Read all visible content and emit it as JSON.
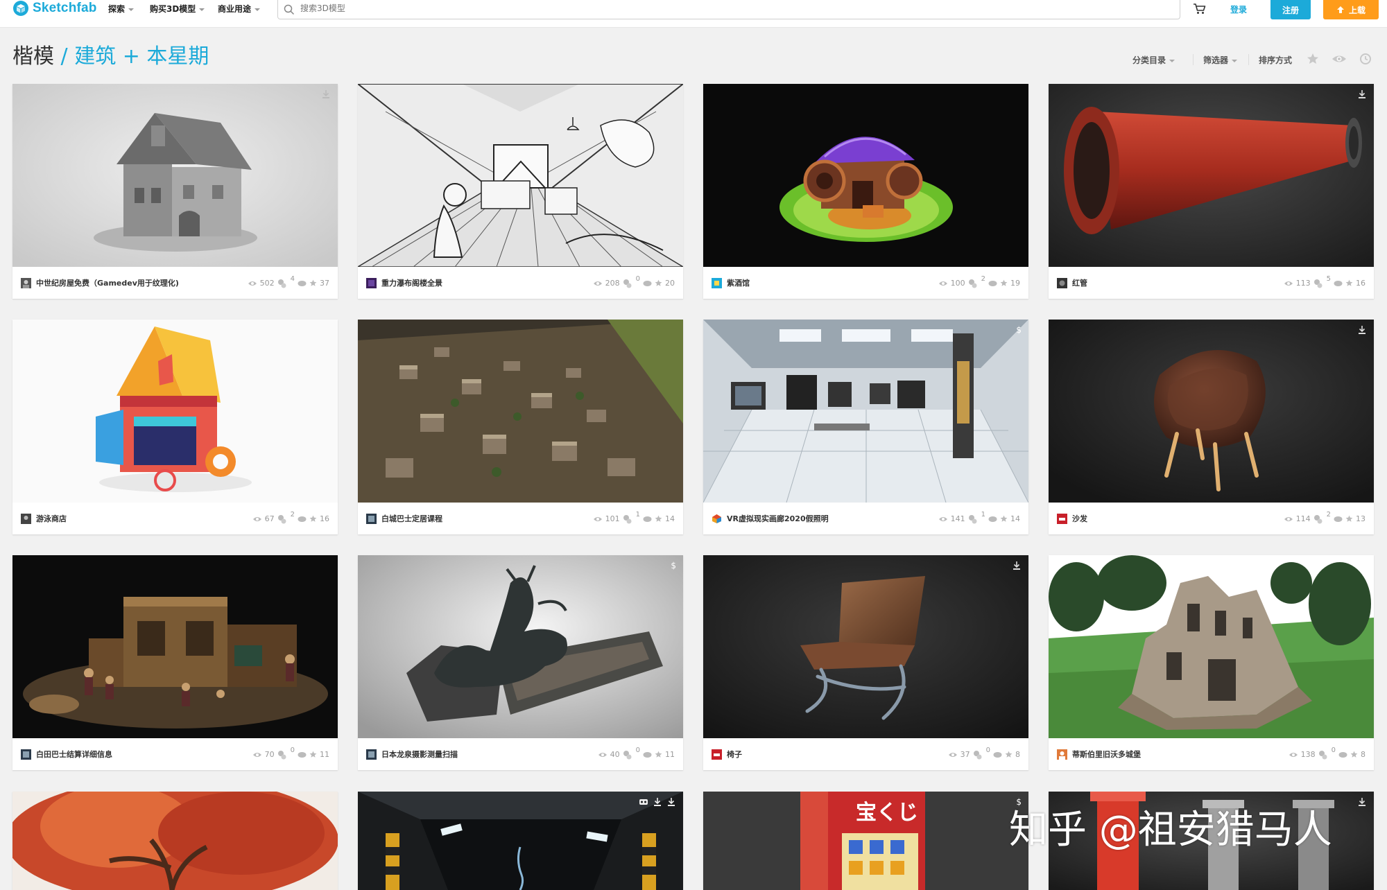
{
  "header": {
    "logo_text": "Sketchfab",
    "nav": [
      "探索",
      "购买3D模型",
      "商业用途"
    ],
    "search_placeholder": "搜索3D模型",
    "login_label": "登录",
    "register_label": "注册",
    "upload_label": "上载"
  },
  "page": {
    "title_main": "楷模",
    "title_sep": "/",
    "title_link": "建筑 + 本星期"
  },
  "toolbar": {
    "category_label": "分类目录",
    "filter_label": "筛选器",
    "sort_label": "排序方式",
    "icons": [
      "star-icon",
      "eye-icon",
      "clock-icon"
    ]
  },
  "models": [
    {
      "name": "中世纪房屋免费（Gamedev用于纹理化)",
      "views": "502",
      "comments": "4",
      "likes": "37",
      "corner": "download"
    },
    {
      "name": "重力瀑布阁楼全景",
      "views": "208",
      "comments": "0",
      "likes": "20",
      "corner": ""
    },
    {
      "name": "紫酒馆",
      "views": "100",
      "comments": "2",
      "likes": "19",
      "corner": ""
    },
    {
      "name": "红管",
      "views": "113",
      "comments": "5",
      "likes": "16",
      "corner": "download"
    },
    {
      "name": "游泳商店",
      "views": "67",
      "comments": "2",
      "likes": "16",
      "corner": ""
    },
    {
      "name": "白城巴士定居课程",
      "views": "101",
      "comments": "1",
      "likes": "14",
      "corner": ""
    },
    {
      "name": "VR虚拟现实画廊2020假照明",
      "views": "141",
      "comments": "1",
      "likes": "14",
      "corner": "$"
    },
    {
      "name": "沙发",
      "views": "114",
      "comments": "2",
      "likes": "13",
      "corner": "download"
    },
    {
      "name": "白田巴士结算详细信息",
      "views": "70",
      "comments": "0",
      "likes": "11",
      "corner": ""
    },
    {
      "name": "日本龙泉摄影测量扫描",
      "views": "40",
      "comments": "0",
      "likes": "11",
      "corner": "$"
    },
    {
      "name": "椅子",
      "views": "37",
      "comments": "0",
      "likes": "8",
      "corner": "download"
    },
    {
      "name": "蒂斯伯里旧沃多城堡",
      "views": "138",
      "comments": "0",
      "likes": "8",
      "corner": "download"
    }
  ],
  "bottom_row": [
    {
      "corner": ""
    },
    {
      "corner": "vr-download"
    },
    {
      "corner": "$",
      "sign_text": "宝くじ"
    },
    {
      "corner": "download"
    }
  ],
  "watermark": "知乎 @祖安猎马人"
}
